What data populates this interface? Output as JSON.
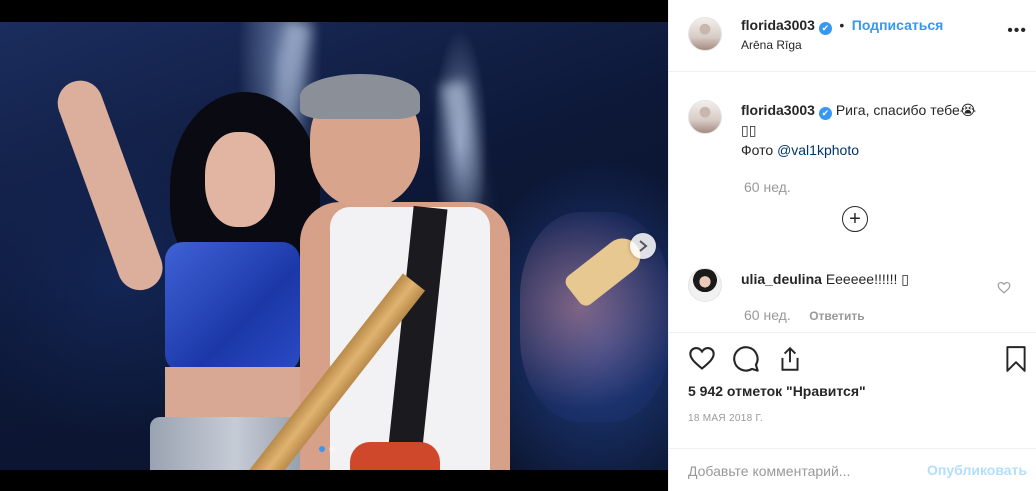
{
  "header": {
    "username": "florida3003",
    "verified_mark": "✔",
    "separator": "•",
    "follow_label": "Подписаться",
    "location": "Arēna Rīga",
    "more_icon": "•••"
  },
  "caption": {
    "username": "florida3003",
    "text": "Рига, спасибо тебе😭",
    "text_line2": "▯▯",
    "photo_prefix": "Фото",
    "mention": "@val1kphoto",
    "time": "60 нед."
  },
  "load_more_icon": "+",
  "comments": [
    {
      "username": "ulia_deulina",
      "text": "Eeeeee!!!!!! ▯",
      "time": "60 нед.",
      "reply_label": "Ответить"
    }
  ],
  "actions": {
    "likes": "5 942 отметок \"Нравится\"",
    "date": "18 мая 2018 г."
  },
  "comment_box": {
    "placeholder": "Добавьте комментарий...",
    "publish_label": "Опубликовать"
  },
  "colors": {
    "accent": "#3897f0",
    "text": "#262626",
    "muted": "#999999",
    "disabled_publish": "#b2dffc"
  },
  "carousel": {
    "slides": 2,
    "active_slide": 1
  }
}
